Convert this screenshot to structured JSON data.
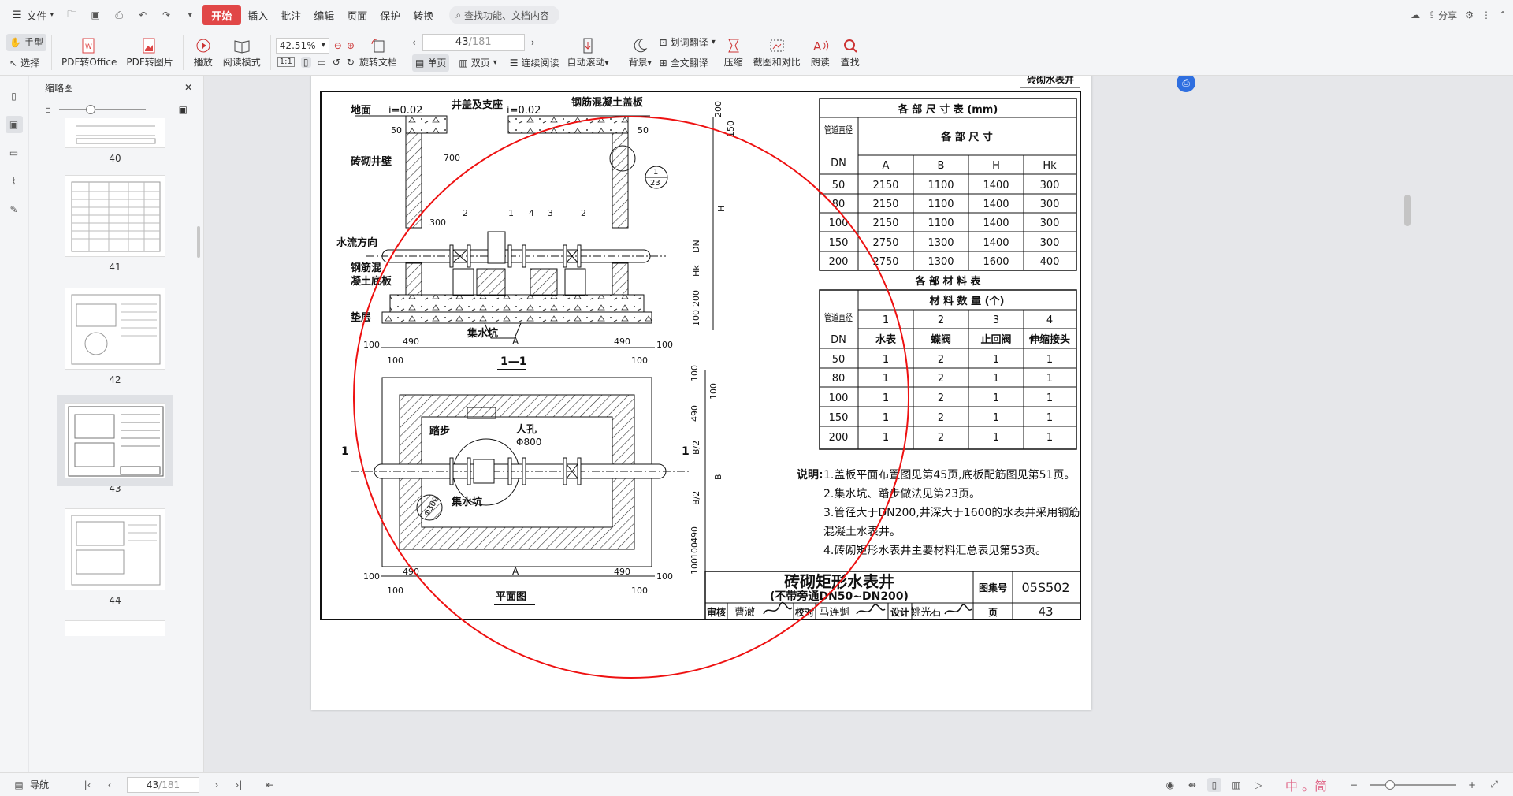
{
  "tabbar": {
    "file_menu": "文件",
    "tabs": [
      {
        "label": "开始",
        "active": true
      },
      {
        "label": "插入"
      },
      {
        "label": "批注"
      },
      {
        "label": "编辑"
      },
      {
        "label": "页面"
      },
      {
        "label": "保护"
      },
      {
        "label": "转换"
      }
    ],
    "search_placeholder": "查找功能、文档内容",
    "share_label": "分享",
    "accent_color": "#e14747"
  },
  "ribbon": {
    "hand_label": "手型",
    "select_label": "选择",
    "pdf_to_office": "PDF转Office",
    "pdf_to_image": "PDF转图片",
    "play": "播放",
    "read_mode": "阅读模式",
    "zoom_value": "42.51%",
    "rotate_doc": "旋转文档",
    "page_current": "43",
    "page_total": "/181",
    "single_page": "单页",
    "double_page": "双页",
    "continuous": "连续阅读",
    "auto_scroll": "自动滚动",
    "background": "背景",
    "word_translate": "划词翻译",
    "full_translate": "全文翻译",
    "compress": "压缩",
    "screenshot_compare": "截图和对比",
    "read_aloud": "朗读",
    "find": "查找"
  },
  "thumbs": {
    "title": "缩略图",
    "items": [
      {
        "num": "40"
      },
      {
        "num": "41"
      },
      {
        "num": "42"
      },
      {
        "num": "43",
        "active": true
      },
      {
        "num": "44"
      }
    ]
  },
  "drawing": {
    "header_title": "砖砌水表井",
    "dim_table_title": "各 部 尺 寸 表 (mm)",
    "dim_header_pipe": "管道直径",
    "dim_header_dn": "DN",
    "dim_header_sizes": "各 部 尺 寸",
    "dim_cols": [
      "A",
      "B",
      "H",
      "Hk"
    ],
    "dim_rows": [
      [
        "50",
        "2150",
        "1100",
        "1400",
        "300"
      ],
      [
        "80",
        "2150",
        "1100",
        "1400",
        "300"
      ],
      [
        "100",
        "2150",
        "1100",
        "1400",
        "300"
      ],
      [
        "150",
        "2750",
        "1300",
        "1400",
        "300"
      ],
      [
        "200",
        "2750",
        "1300",
        "1600",
        "400"
      ]
    ],
    "mat_table_title": "各 部 材 料 表",
    "mat_header_qty": "材 料 数 量 (个)",
    "mat_nums": [
      "1",
      "2",
      "3",
      "4"
    ],
    "mat_names": [
      "水表",
      "蝶阀",
      "止回阀",
      "伸缩接头"
    ],
    "mat_rows": [
      [
        "50",
        "1",
        "2",
        "1",
        "1"
      ],
      [
        "80",
        "1",
        "2",
        "1",
        "1"
      ],
      [
        "100",
        "1",
        "2",
        "1",
        "1"
      ],
      [
        "150",
        "1",
        "2",
        "1",
        "1"
      ],
      [
        "200",
        "1",
        "2",
        "1",
        "1"
      ]
    ],
    "notes_label": "说明:",
    "notes": [
      "1.盖板平面布置图见第45页,底板配筋图见第51页。",
      "2.集水坑、踏步做法见第23页。",
      "3.管径大于DN200,井深大于1600的水表井采用钢筋",
      "   混凝土水表井。",
      "4.砖砌矩形水表井主要材料汇总表见第53页。"
    ],
    "title_main": "砖砌矩形水表井",
    "title_sub": "(不带旁通DN50~DN200)",
    "atlas_label": "图集号",
    "atlas_no": "05S502",
    "page_label": "页",
    "page_no": "43",
    "sign_row": [
      "审核",
      "曹澈",
      "校对",
      "马连魁",
      "设计",
      "姚光石"
    ],
    "section_labels": {
      "ground": "地面",
      "slope1": "i=0.02",
      "slope2": "i=0.02",
      "cover_seat": "井盖及支座",
      "rc_cover": "钢筋混凝土盖板",
      "brick_wall": "砖砌井壁",
      "flow_dir": "水流方向",
      "rc_base1": "钢筋混",
      "rc_base2": "凝土底板",
      "cushion": "垫层",
      "sump": "集水坑",
      "section_name": "1—1",
      "plan_name": "平面图",
      "step": "踏步",
      "manhole": "人孔",
      "manhole_dia": "Φ800",
      "sump2": "集水坑",
      "sump_dia": "Φ300",
      "cut_mark": "1",
      "detail_num": "1",
      "detail_page": "23"
    },
    "dims": {
      "d50": "50",
      "d700": "700",
      "d300": "300",
      "d490": "490",
      "d100": "100",
      "dA": "A",
      "dB": "B",
      "dB2": "B/2",
      "dH": "H",
      "dDN": "DN",
      "dHk": "Hk",
      "d200": "200",
      "d150": "150",
      "d100v": "100",
      "c1": "1",
      "c2": "2",
      "c4": "4",
      "c3": "3"
    }
  },
  "statusbar": {
    "nav_label": "导航",
    "page_current": "43",
    "page_total": "/181",
    "ime": "中 。简"
  }
}
